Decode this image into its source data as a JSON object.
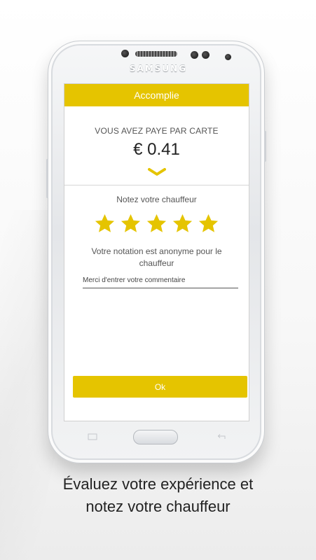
{
  "device": {
    "brand": "SAMSUNG"
  },
  "screen": {
    "header_title": "Accomplie",
    "payment_label": "VOUS AVEZ PAYE PAR CARTE",
    "amount": "€ 0.41",
    "rating_prompt": "Notez votre chauffeur",
    "rating": {
      "value": 5,
      "max": 5
    },
    "anonymity_note": "Votre notation est anonyme pour le chauffeur",
    "comment_placeholder": "Merci d'entrer votre commentaire",
    "ok_label": "Ok",
    "accent_color": "#e5c400"
  },
  "caption": {
    "line1": "Évaluez votre expérience et",
    "line2": "notez votre chauffeur"
  }
}
